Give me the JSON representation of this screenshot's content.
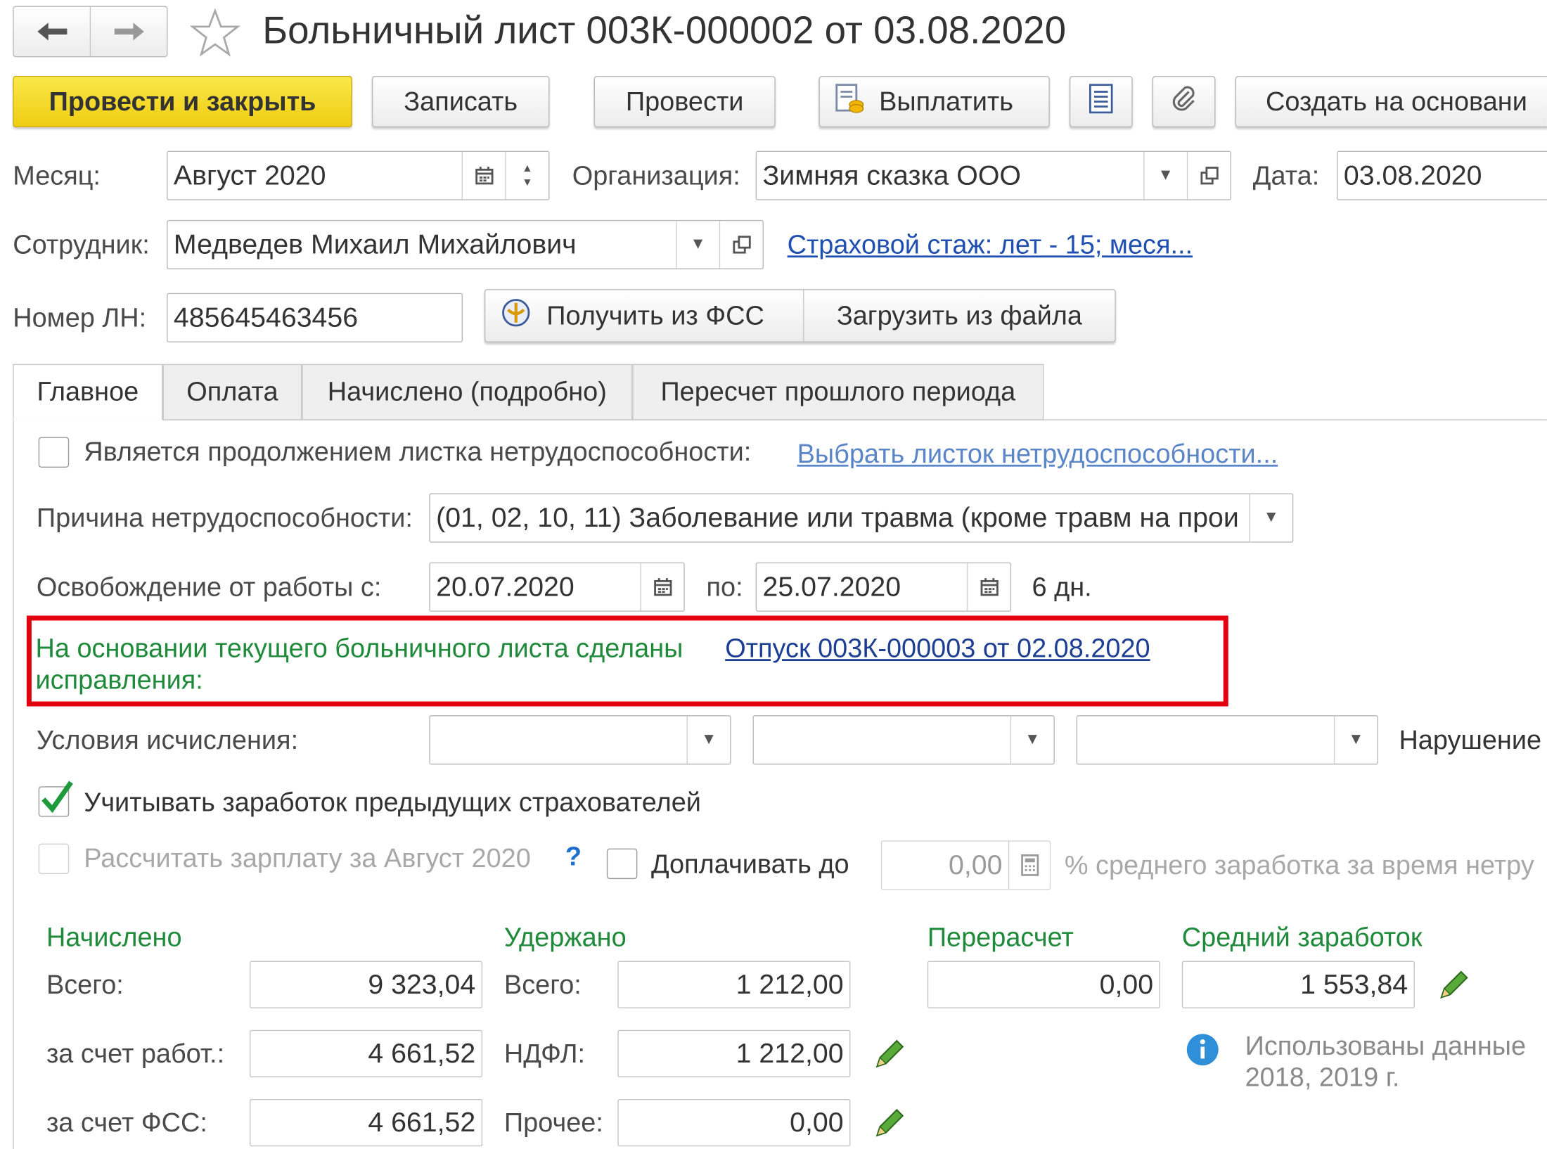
{
  "window": {
    "title": "Больничный лист 003К-000002 от 03.08.2020"
  },
  "toolbar": {
    "post_close": "Провести и закрыть",
    "save": "Записать",
    "post": "Провести",
    "pay": "Выплатить",
    "create_based_on": "Создать на основани"
  },
  "header": {
    "month_label": "Месяц:",
    "month_value": "Август 2020",
    "org_label": "Организация:",
    "org_value": "Зимняя сказка ООО",
    "date_label": "Дата:",
    "date_value": "03.08.2020",
    "employee_label": "Сотрудник:",
    "employee_value": "Медведев Михаил Михайлович",
    "insurance_link": "Страховой стаж: лет - 15; меся...",
    "ln_label": "Номер ЛН:",
    "ln_value": "485645463456",
    "get_fss": "Получить из ФСС",
    "load_file": "Загрузить из файла"
  },
  "tabs": [
    "Главное",
    "Оплата",
    "Начислено (подробно)",
    "Пересчет прошлого периода"
  ],
  "main": {
    "continuation_label": "Является продолжением листка нетрудоспособности:",
    "choose_sheet_link": "Выбрать листок нетрудоспособности...",
    "reason_label": "Причина нетрудоспособности:",
    "reason_value": "(01, 02, 10, 11) Заболевание или травма (кроме травм на прои",
    "release_label": "Освобождение от работы с:",
    "release_from": "20.07.2020",
    "release_to_label": "по:",
    "release_to": "25.07.2020",
    "days": "6 дн.",
    "corrections_text_1": "На основании текущего больничного листа сделаны",
    "corrections_text_2": "исправления:",
    "corrections_link": "Отпуск 003К-000003 от 02.08.2020",
    "conditions_label": "Условия исчисления:",
    "violation_label": "Нарушение",
    "prev_employers_label": "Учитывать заработок предыдущих страхователей",
    "calc_salary_label": "Рассчитать зарплату за Август 2020",
    "help_mark": "?",
    "topup_label": "Доплачивать до",
    "topup_value": "0,00",
    "avg_percent_label": "% среднего заработка за время нетру"
  },
  "summary": {
    "accrued_header": "Начислено",
    "withheld_header": "Удержано",
    "recalc_header": "Перерасчет",
    "avg_header": "Средний заработок",
    "total_label": "Всего:",
    "employer_label": "за счет работ.:",
    "fss_label": "за счет ФСС:",
    "ndfl_label": "НДФЛ:",
    "other_label": "Прочее:",
    "accrued_total": "9 323,04",
    "accrued_employer": "4 661,52",
    "accrued_fss": "4 661,52",
    "withheld_total": "1 212,00",
    "withheld_ndfl": "1 212,00",
    "withheld_other": "0,00",
    "recalc_total": "0,00",
    "avg_value": "1 553,84",
    "info_text_1": "Использованы данные",
    "info_text_2": "2018,  2019 г."
  },
  "colors": {
    "accent_yellow": "#f5d92c",
    "green_text": "#1e8a3a",
    "link_blue": "#1f4fb0",
    "highlight_red": "#e3000f"
  }
}
